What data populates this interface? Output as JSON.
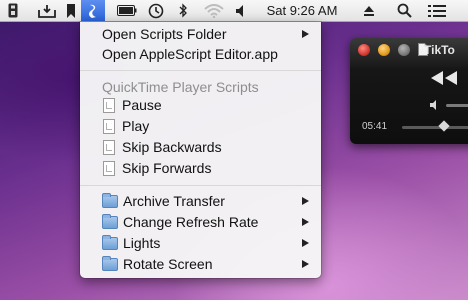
{
  "menubar": {
    "clock": "Sat 9:26 AM",
    "icons": [
      "usb-drive-icon",
      "inbox-icon",
      "bookmark-icon",
      "script-menu-icon",
      "battery-icon",
      "time-machine-icon",
      "bluetooth-icon",
      "wifi-icon",
      "volume-icon",
      "eject-icon",
      "spotlight-icon",
      "notification-list-icon"
    ]
  },
  "menu": {
    "top_items": [
      {
        "label": "Open Scripts Folder",
        "has_submenu": true
      },
      {
        "label": "Open AppleScript Editor.app",
        "has_submenu": false
      }
    ],
    "section_header": "QuickTime Player Scripts",
    "scripts": [
      {
        "label": "Pause"
      },
      {
        "label": "Play"
      },
      {
        "label": "Skip Backwards"
      },
      {
        "label": "Skip Forwards"
      }
    ],
    "folders": [
      {
        "label": "Archive Transfer"
      },
      {
        "label": "Change Refresh Rate"
      },
      {
        "label": "Lights"
      },
      {
        "label": "Rotate Screen"
      }
    ]
  },
  "player": {
    "title": "TikTo",
    "time": "05:41"
  },
  "colors": {
    "menu_highlight": "#3d75e6",
    "player_bg": "#161616",
    "close": "#e0443c",
    "minimize": "#e7a32a"
  }
}
